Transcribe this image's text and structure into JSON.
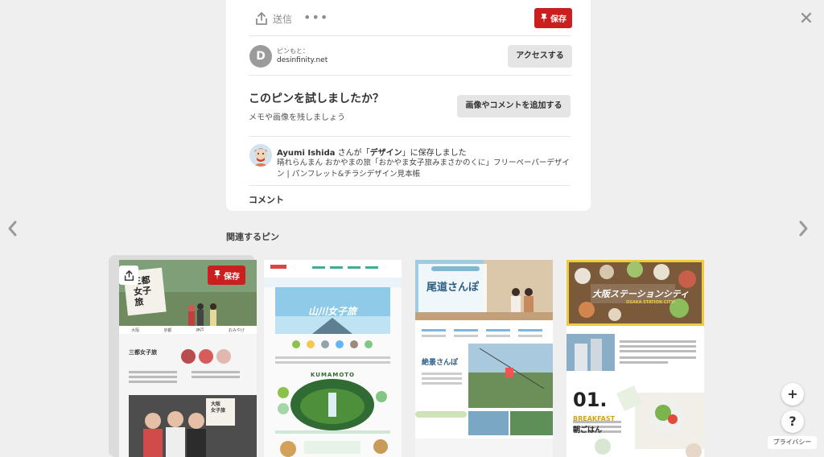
{
  "toolbar": {
    "send_label": "送信",
    "more_label": "•••",
    "save_label": "保存"
  },
  "source": {
    "avatar_letter": "D",
    "label": "ピンもと：",
    "domain": "desinfinity.net",
    "visit_label": "アクセスする"
  },
  "tried": {
    "title": "このピンを試しましたか？",
    "subtitle": "メモや画像を残しましょう",
    "add_photo_label": "画像やコメントを追加する"
  },
  "saver": {
    "name": "Ayumi Ishida",
    "action_prefix": " さんが「",
    "board": "デザイン",
    "action_suffix": "」に保存しました",
    "description": "晴れらんまん おかやまの旅「おかやま女子旅みまさかのくに」フリーペーパーデザイン | パンフレット&チラシデザイン見本帳"
  },
  "comment_label": "コメント",
  "related": {
    "heading": "関連するピン",
    "save_label": "保存",
    "pins": [
      {
        "title_lines": [
          "三都",
          "女子旅"
        ],
        "nav": [
          "大阪",
          "京都",
          "神戸",
          "おみやげ"
        ],
        "heading": "三都女子旅",
        "bottom_label": [
          "大阪",
          "女子旅"
        ]
      },
      {
        "title": "山川女子旅",
        "city": "KUMAMOTO"
      },
      {
        "title": "尾道さんぽ",
        "sub": "絶景さんぽ"
      },
      {
        "title": "大阪ステーションシティ",
        "subtitle": "OSAKA STATION CITY",
        "number": "01.",
        "label1": "BREAKFAST",
        "label2": "朝ごはん"
      }
    ]
  },
  "fab": {
    "plus": "+",
    "help": "?",
    "privacy": "プライバシー"
  },
  "colors": {
    "save_red": "#cb1f1f",
    "bg": "#efefef"
  }
}
